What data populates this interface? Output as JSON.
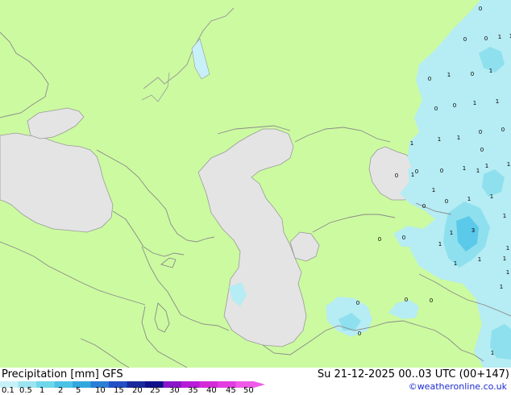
{
  "map": {
    "model_label": "Precipitation [mm]  GFS",
    "datetime_label": "Su 21-12-2025 00..03 UTC (00+147)",
    "credit": "©weatheronline.co.uk",
    "colors": {
      "land": "#ccfaa0",
      "water": "#e4e4e4",
      "border": "#8a8a8a",
      "coast": "#9a9a9a",
      "precip_low": "#b6ecf3",
      "precip_mid": "#8ee0ee",
      "precip_high": "#5bc9e9"
    },
    "scale": {
      "labels": [
        "0.1",
        "0.5",
        "1",
        "2",
        "5",
        "10",
        "15",
        "20",
        "25",
        "30",
        "35",
        "40",
        "45",
        "50"
      ],
      "colors": [
        "#c8f0f8",
        "#9ce5f0",
        "#6fd7eb",
        "#4cc3e6",
        "#31a7de",
        "#2a7ed4",
        "#2350c4",
        "#1a2a9c",
        "#10108a",
        "#8a18c8",
        "#b81cd8",
        "#d42ad8",
        "#e23de0",
        "#f05ae8"
      ]
    },
    "station_values": [
      "0",
      "1",
      "0",
      "0",
      "1",
      "1",
      "0",
      "1",
      "0",
      "1",
      "0",
      "1",
      "0",
      "0",
      "1",
      "1",
      "0",
      "1",
      "0",
      "1",
      "0",
      "1",
      "0",
      "1",
      "1",
      "0",
      "1",
      "1",
      "0",
      "0",
      "1",
      "3",
      "1",
      "0",
      "0",
      "1",
      "1",
      "1",
      "0",
      "1",
      "0",
      "1",
      "1",
      "1",
      "1",
      "0",
      "0",
      "1",
      "1"
    ]
  }
}
